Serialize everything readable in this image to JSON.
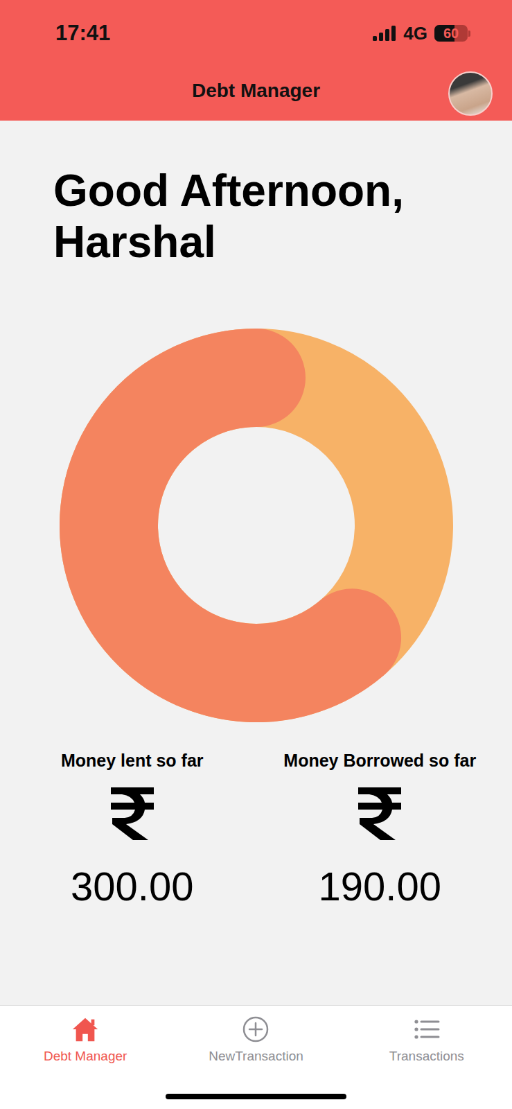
{
  "status_bar": {
    "time": "17:41",
    "network": "4G",
    "battery": {
      "text": "60",
      "level": 0.6
    }
  },
  "header": {
    "title": "Debt Manager"
  },
  "greeting": {
    "line1": "Good Afternoon,",
    "line2": "Harshal"
  },
  "summary": [
    {
      "label": "Money lent so far",
      "amount": "300.00",
      "value": 300,
      "color": "#F4845F"
    },
    {
      "label": "Money Borrowed so far",
      "amount": "190.00",
      "value": 190,
      "color": "#F7B267"
    }
  ],
  "tabs": [
    {
      "label": "Debt Manager",
      "selected": true,
      "kind": "home"
    },
    {
      "label": "NewTransaction",
      "selected": false,
      "kind": "add"
    },
    {
      "label": "Transactions",
      "selected": false,
      "kind": "list"
    }
  ]
}
